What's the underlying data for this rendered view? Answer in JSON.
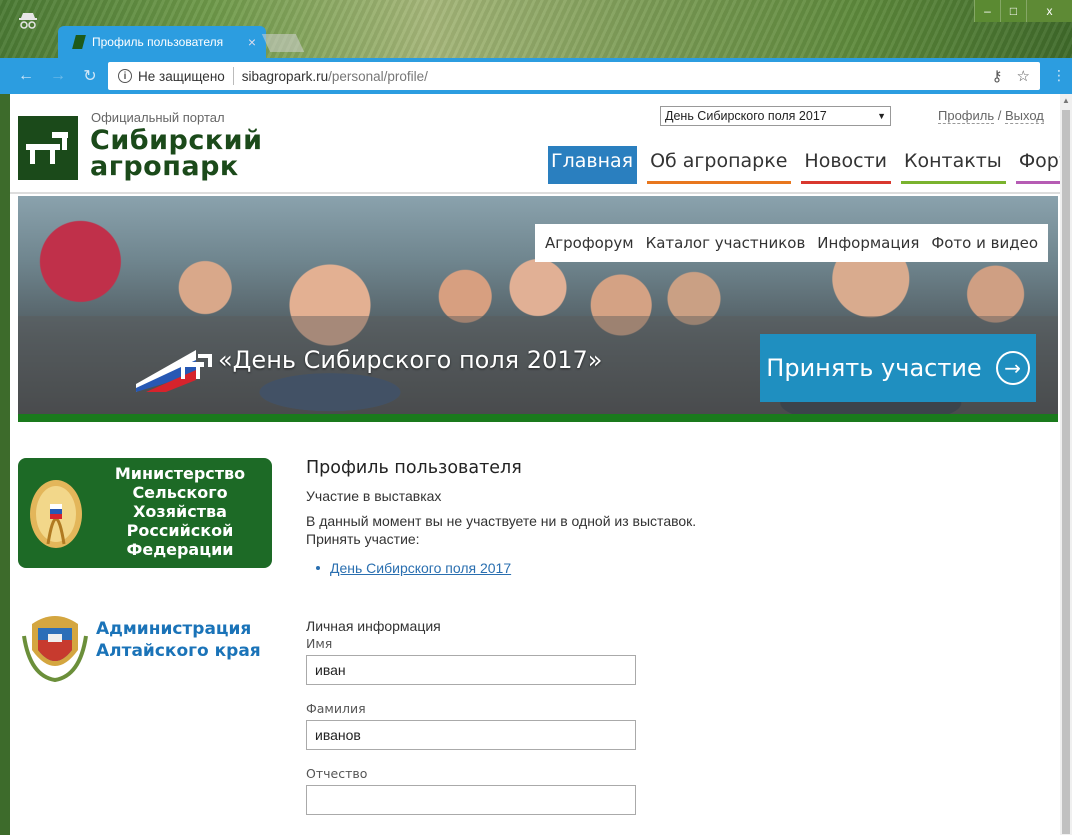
{
  "browser": {
    "tab_title": "Профиль пользователя",
    "tab_close": "×",
    "security_label": "Не защищено",
    "url_domain": "sibagropark.ru",
    "url_path": "/personal/profile/",
    "window_controls": {
      "minimize": "–",
      "maximize": "□",
      "close": "x"
    }
  },
  "header": {
    "portal_caption": "Официальный портал",
    "brand_line1": "Сибирский",
    "brand_line2": "агропарк",
    "event_select_value": "День Сибирского поля 2017",
    "auth_profile": "Профиль",
    "auth_sep": " / ",
    "auth_logout": "Выход"
  },
  "main_nav": [
    {
      "label": "Главная",
      "color": "#2a7fbf",
      "active": true
    },
    {
      "label": "Об агропарке",
      "color": "#e8771e",
      "active": false
    },
    {
      "label": "Новости",
      "color": "#d9382e",
      "active": false
    },
    {
      "label": "Контакты",
      "color": "#7ab32e",
      "active": false
    },
    {
      "label": "Форум",
      "color": "#b65cb4",
      "active": false
    }
  ],
  "sub_nav": [
    "Агрофорум",
    "Каталог участников",
    "Информация",
    "Фото и видео"
  ],
  "hero": {
    "headline": "«День Сибирского поля 2017»",
    "join_button": "Принять участие",
    "join_icon": "arrow-right-circle-icon"
  },
  "sidebar": {
    "ministry_lines": [
      "Министерство",
      "Сельского",
      "Хозяйства",
      "Российской",
      "Федерации"
    ],
    "admin_lines": [
      "Администрация",
      "Алтайского края"
    ]
  },
  "content": {
    "page_title": "Профиль пользователя",
    "exhibitions_heading": "Участие в выставках",
    "no_participation": "В данный момент вы не участвуете ни в одной из выставок.",
    "join_prompt": "Принять участие:",
    "exhibition_link": "День Сибирского поля 2017",
    "personal_heading": "Личная информация",
    "fields": {
      "first_name": {
        "label": "Имя",
        "value": "иван"
      },
      "last_name": {
        "label": "Фамилия",
        "value": "иванов"
      },
      "patronymic": {
        "label": "Отчество",
        "value": ""
      }
    }
  },
  "colors": {
    "brand_dark_green": "#1b4a1a",
    "accent_blue": "#2a7fbf",
    "link_blue": "#2a6fb0",
    "strip_green": "#1a7a1c",
    "chrome_blue": "#2c9de0"
  }
}
